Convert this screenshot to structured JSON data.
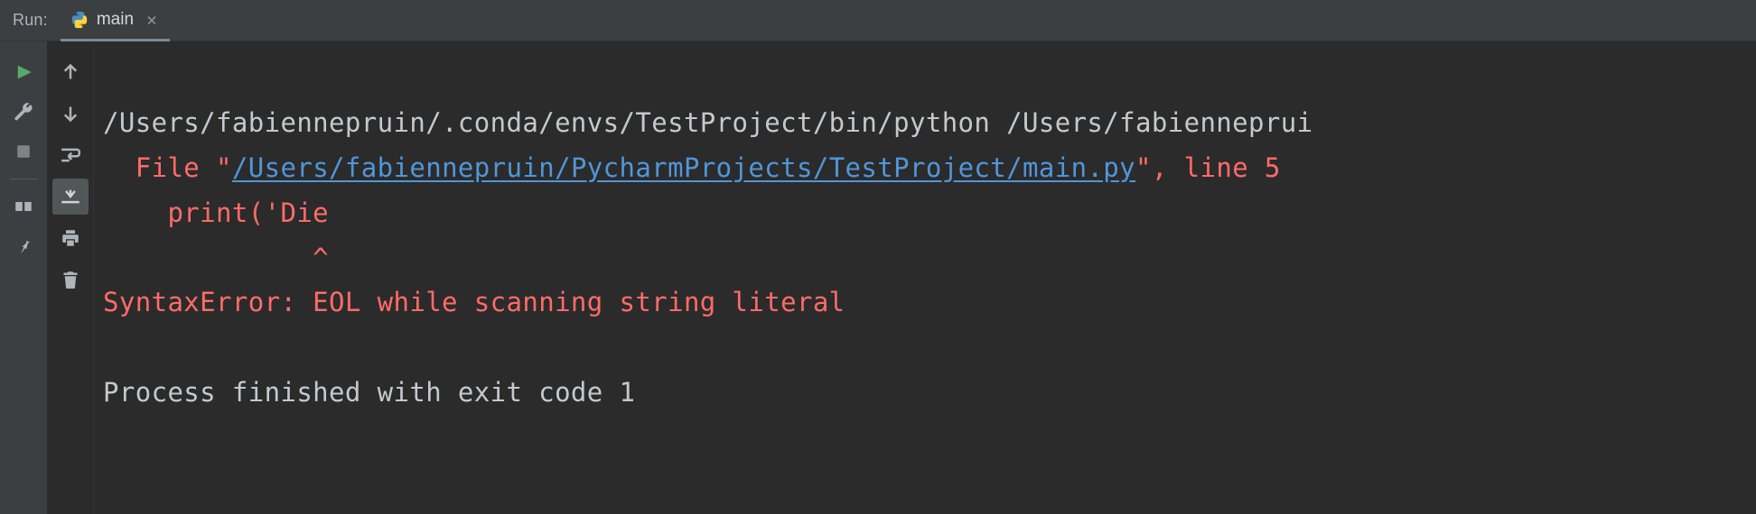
{
  "titlebar": {
    "run_label": "Run:",
    "tab_label": "main",
    "close_glyph": "×"
  },
  "console": {
    "cmd": "/Users/fabiennepruin/.conda/envs/TestProject/bin/python /Users/fabienneprui",
    "file_prefix": "  File \"",
    "file_link": "/Users/fabiennepruin/PycharmProjects/TestProject/main.py",
    "file_suffix": "\", line 5",
    "code_line": "    print('Die",
    "caret_line": "             ^",
    "error_line": "SyntaxError: EOL while scanning string literal",
    "exit_line": "Process finished with exit code 1"
  }
}
